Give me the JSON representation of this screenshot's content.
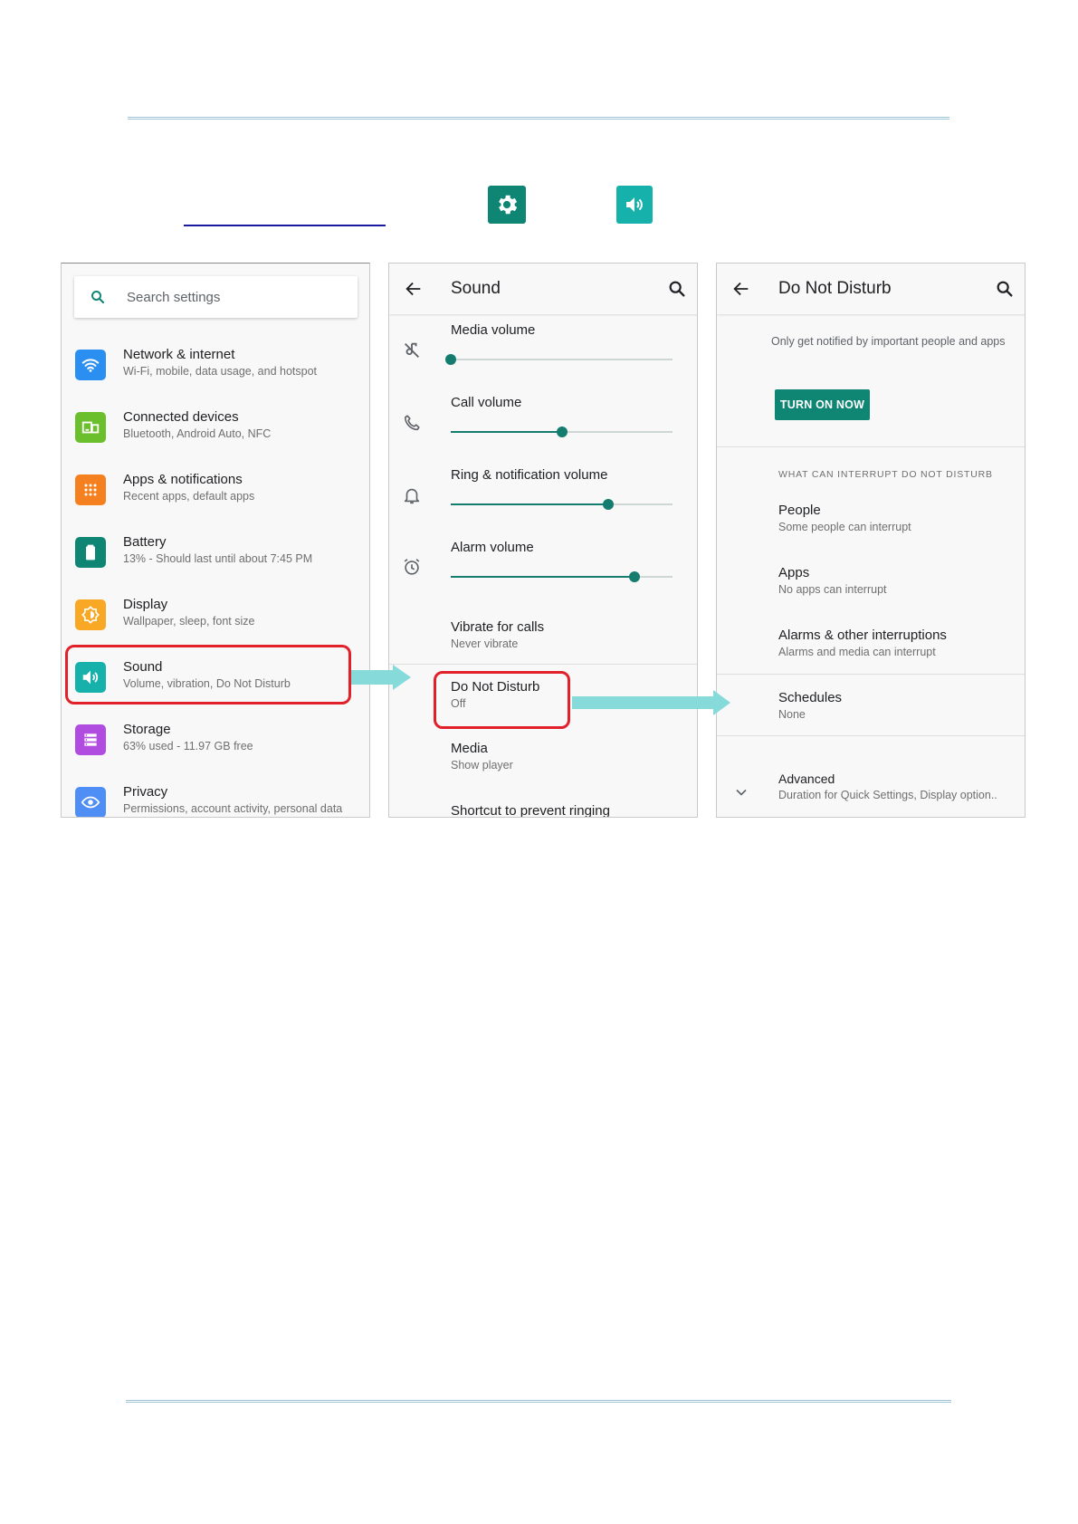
{
  "settings_panel": {
    "search_placeholder": "Search settings",
    "items": [
      {
        "title": "Network & internet",
        "subtitle": "Wi-Fi, mobile, data usage, and hotspot",
        "icon": "wifi-icon",
        "color": "#2a8ff0"
      },
      {
        "title": "Connected devices",
        "subtitle": "Bluetooth, Android Auto, NFC",
        "icon": "devices-icon",
        "color": "#6cbf2c"
      },
      {
        "title": "Apps & notifications",
        "subtitle": "Recent apps, default apps",
        "icon": "apps-grid-icon",
        "color": "#f5801f"
      },
      {
        "title": "Battery",
        "subtitle": "13% - Should last until about 7:45 PM",
        "icon": "battery-icon",
        "color": "#0f8574"
      },
      {
        "title": "Display",
        "subtitle": "Wallpaper, sleep, font size",
        "icon": "brightness-icon",
        "color": "#f9a825"
      },
      {
        "title": "Sound",
        "subtitle": "Volume, vibration, Do Not Disturb",
        "icon": "volume-icon",
        "color": "#17b1ab"
      },
      {
        "title": "Storage",
        "subtitle": "63% used - 11.97 GB free",
        "icon": "storage-icon",
        "color": "#b04ce0"
      },
      {
        "title": "Privacy",
        "subtitle": "Permissions, account activity, personal data",
        "icon": "privacy-eye-icon",
        "color": "#4f8ef5"
      }
    ]
  },
  "sound_panel": {
    "title": "Sound",
    "sliders": [
      {
        "label": "Media volume",
        "icon": "music-off-icon",
        "level": 0.0
      },
      {
        "label": "Call volume",
        "icon": "phone-icon",
        "level": 0.5
      },
      {
        "label": "Ring & notification volume",
        "icon": "bell-icon",
        "level": 0.71
      },
      {
        "label": "Alarm volume",
        "icon": "alarm-clock-icon",
        "level": 0.83
      }
    ],
    "vibrate": {
      "title": "Vibrate for calls",
      "subtitle": "Never vibrate"
    },
    "dnd": {
      "title": "Do Not Disturb",
      "subtitle": "Off"
    },
    "media": {
      "title": "Media",
      "subtitle": "Show player"
    },
    "shortcut": {
      "title": "Shortcut to prevent ringing"
    }
  },
  "dnd_panel": {
    "title": "Do Not Disturb",
    "description": "Only get notified by important people and apps",
    "turn_on_label": "TURN ON NOW",
    "section_header": "WHAT CAN INTERRUPT DO NOT DISTURB",
    "people": {
      "title": "People",
      "subtitle": "Some people can interrupt"
    },
    "apps": {
      "title": "Apps",
      "subtitle": "No apps can interrupt"
    },
    "alarms": {
      "title": "Alarms & other interruptions",
      "subtitle": "Alarms and media can interrupt"
    },
    "schedules": {
      "title": "Schedules",
      "subtitle": "None"
    },
    "advanced": {
      "title": "Advanced",
      "subtitle": "Duration for Quick Settings, Display option.."
    }
  },
  "colors": {
    "accent": "#0f8574",
    "highlight": "#e2202a",
    "arrow": "#86dada"
  }
}
